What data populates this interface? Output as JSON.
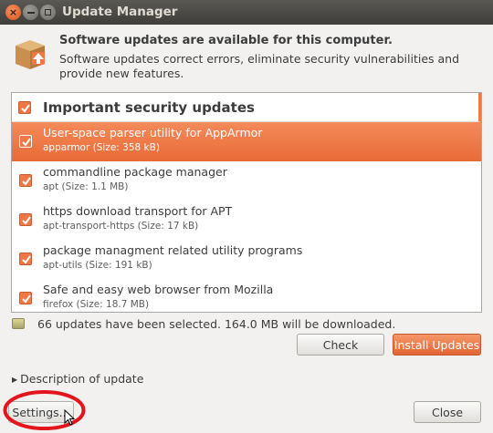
{
  "window": {
    "title": "Update Manager",
    "close_glyph": "×"
  },
  "header": {
    "title": "Software updates are available for this computer.",
    "description": "Software updates correct errors, eliminate security vulnerabilities and provide new features.",
    "icon": "package-icon"
  },
  "update_list": {
    "group_label": "Important security updates",
    "group_checked": true,
    "items": [
      {
        "title": "User-space parser utility for AppArmor",
        "subtitle": "apparmor (Size: 358 kB)",
        "checked": true,
        "selected": true
      },
      {
        "title": "commandline package manager",
        "subtitle": "apt (Size: 1.1 MB)",
        "checked": true,
        "selected": false
      },
      {
        "title": "https download transport for APT",
        "subtitle": "apt-transport-https (Size: 17 kB)",
        "checked": true,
        "selected": false
      },
      {
        "title": "package managment related utility programs",
        "subtitle": "apt-utils (Size: 191 kB)",
        "checked": true,
        "selected": false
      },
      {
        "title": "Safe and easy web browser from Mozilla",
        "subtitle": "firefox (Size: 18.7 MB)",
        "checked": true,
        "selected": false
      }
    ]
  },
  "status": {
    "text": "66 updates have been selected. 164.0 MB will be downloaded."
  },
  "buttons": {
    "check": "Check",
    "install": "Install Updates",
    "settings": "Settings...",
    "close": "Close"
  },
  "expander": {
    "label": "Description of update",
    "arrow": "▶"
  },
  "colors": {
    "accent": "#f07746",
    "selection": "#e86b37",
    "annotation": "#e4141c"
  }
}
